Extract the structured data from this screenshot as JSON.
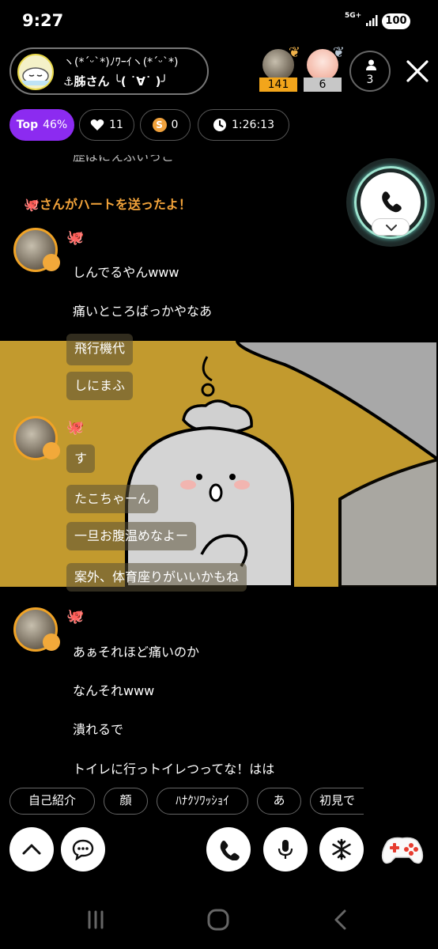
{
  "status_bar": {
    "time": "9:27",
    "network": "5G+",
    "battery": "100"
  },
  "header": {
    "host_title": "ヽ(*´ᵕ`*)ﾉﾜｰｲヽ(*´ᵕ`*)",
    "host_name": "⚓胏さん ╰( ˙∀˙ )╯",
    "ranks": [
      {
        "value": "141",
        "badge_color": "#f2a51b",
        "text_color": "#000"
      },
      {
        "value": "6",
        "badge_color": "#c7c7c7",
        "text_color": "#000"
      }
    ],
    "viewer_count": "3"
  },
  "stats": {
    "top_label": "Top",
    "top_percent": "46%",
    "hearts": "11",
    "coin_symbol": "S",
    "coins": "0",
    "duration": "1:26:13"
  },
  "chat": {
    "cut_line": "歴ばにえぶいっこ",
    "notice": "🐙さんがハートを送ったよ！",
    "group1": {
      "octo": "🐙",
      "messages": [
        "しんでるやんwww",
        "痛いところばっかやなあ"
      ]
    },
    "overlay_bubbles_top": [
      "飛行機代",
      "しにまふ"
    ],
    "group2": {
      "octo": "🐙",
      "bubbles": [
        "す",
        "たこちゃーん",
        "一旦お腹温めなよー",
        "案外、体育座りがいいかもね"
      ]
    },
    "group3": {
      "octo": "🐙",
      "messages": [
        "あぁそれほど痛いのか",
        "なんそれwww",
        "潰れるで",
        "トイレに行っトイレつってな！はは"
      ]
    }
  },
  "quick_replies": [
    "自己紹介",
    "顔",
    "ﾊﾅｸｿﾜｯｼｮｲ",
    "あ",
    "初見で"
  ],
  "colors": {
    "accent_purple": "#8c2bf0",
    "notice_orange": "#f2a33a",
    "scene_yellow": "#c29a2e"
  }
}
